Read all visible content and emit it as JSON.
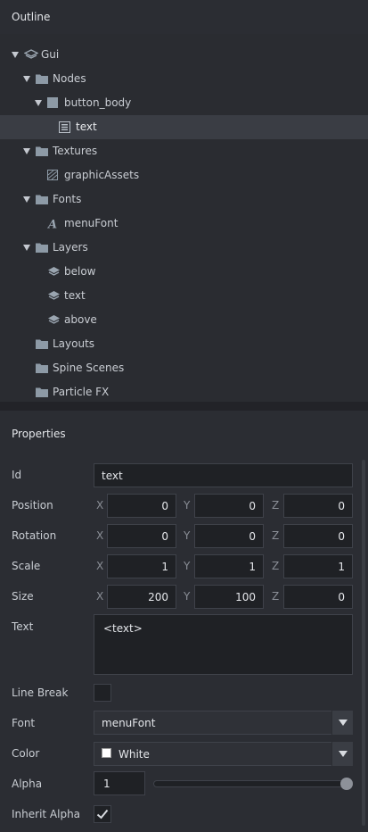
{
  "outline": {
    "title": "Outline",
    "tree": [
      {
        "label": "Gui",
        "icon": "gui-layers-icon",
        "expanded": true
      },
      {
        "label": "Nodes",
        "icon": "folder-icon",
        "expanded": true
      },
      {
        "label": "button_body",
        "icon": "box-node-icon",
        "expanded": true
      },
      {
        "label": "text",
        "icon": "text-node-icon",
        "selected": true
      },
      {
        "label": "Textures",
        "icon": "folder-icon",
        "expanded": true
      },
      {
        "label": "graphicAssets",
        "icon": "texture-atlas-icon"
      },
      {
        "label": "Fonts",
        "icon": "folder-icon",
        "expanded": true
      },
      {
        "label": "menuFont",
        "icon": "font-icon"
      },
      {
        "label": "Layers",
        "icon": "folder-icon",
        "expanded": true
      },
      {
        "label": "below",
        "icon": "layer-icon"
      },
      {
        "label": "text",
        "icon": "layer-icon"
      },
      {
        "label": "above",
        "icon": "layer-icon"
      },
      {
        "label": "Layouts",
        "icon": "folder-icon"
      },
      {
        "label": "Spine Scenes",
        "icon": "folder-icon"
      },
      {
        "label": "Particle FX",
        "icon": "folder-icon"
      }
    ]
  },
  "properties": {
    "title": "Properties",
    "id": {
      "label": "Id",
      "value": "text"
    },
    "position": {
      "label": "Position",
      "x": "0",
      "y": "0",
      "z": "0"
    },
    "rotation": {
      "label": "Rotation",
      "x": "0",
      "y": "0",
      "z": "0"
    },
    "scale": {
      "label": "Scale",
      "x": "1",
      "y": "1",
      "z": "1"
    },
    "size": {
      "label": "Size",
      "x": "200",
      "y": "100",
      "z": "0"
    },
    "axes": {
      "x": "X",
      "y": "Y",
      "z": "Z"
    },
    "text": {
      "label": "Text",
      "value": "<text>"
    },
    "line_break": {
      "label": "Line Break",
      "checked": false
    },
    "font": {
      "label": "Font",
      "value": "menuFont"
    },
    "color": {
      "label": "Color",
      "value": "White",
      "swatch": "#ffffff"
    },
    "alpha": {
      "label": "Alpha",
      "value": "1",
      "level": 1.0
    },
    "inherit_alpha": {
      "label": "Inherit Alpha",
      "checked": true
    }
  },
  "colors": {
    "background": "#2b2d33",
    "selection": "#3a3d44",
    "field": "#1f2125",
    "icon": "#8d9aa6"
  }
}
